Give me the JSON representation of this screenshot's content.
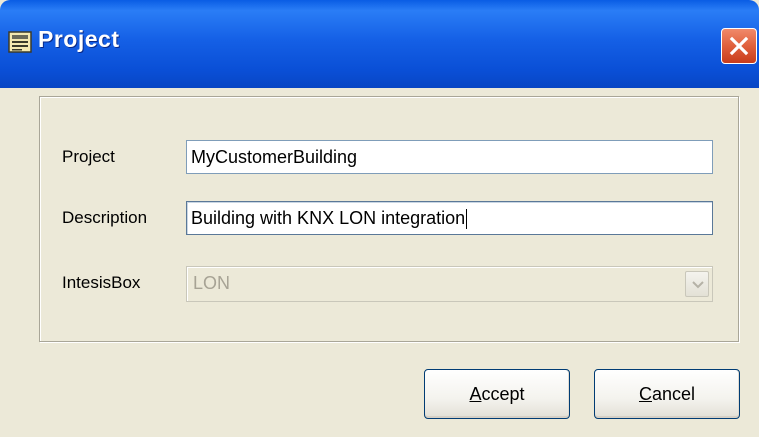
{
  "window": {
    "title": "Project",
    "title_icon": "database-window-icon",
    "close_icon": "close-icon"
  },
  "form": {
    "project_label": "Project",
    "project_value": "MyCustomerBuilding",
    "description_label": "Description",
    "description_value": "Building with KNX LON integration",
    "intesisbox_label": "IntesisBox",
    "intesisbox_value": "LON",
    "intesisbox_enabled": false
  },
  "buttons": {
    "accept_mnemonic": "A",
    "accept_rest": "ccept",
    "cancel_mnemonic": "C",
    "cancel_rest": "ancel"
  },
  "colors": {
    "titlebar": "#0a4fd6",
    "dialog_bg": "#ece9d8",
    "close_button": "#e0603c",
    "disabled_text": "#a7a395"
  }
}
